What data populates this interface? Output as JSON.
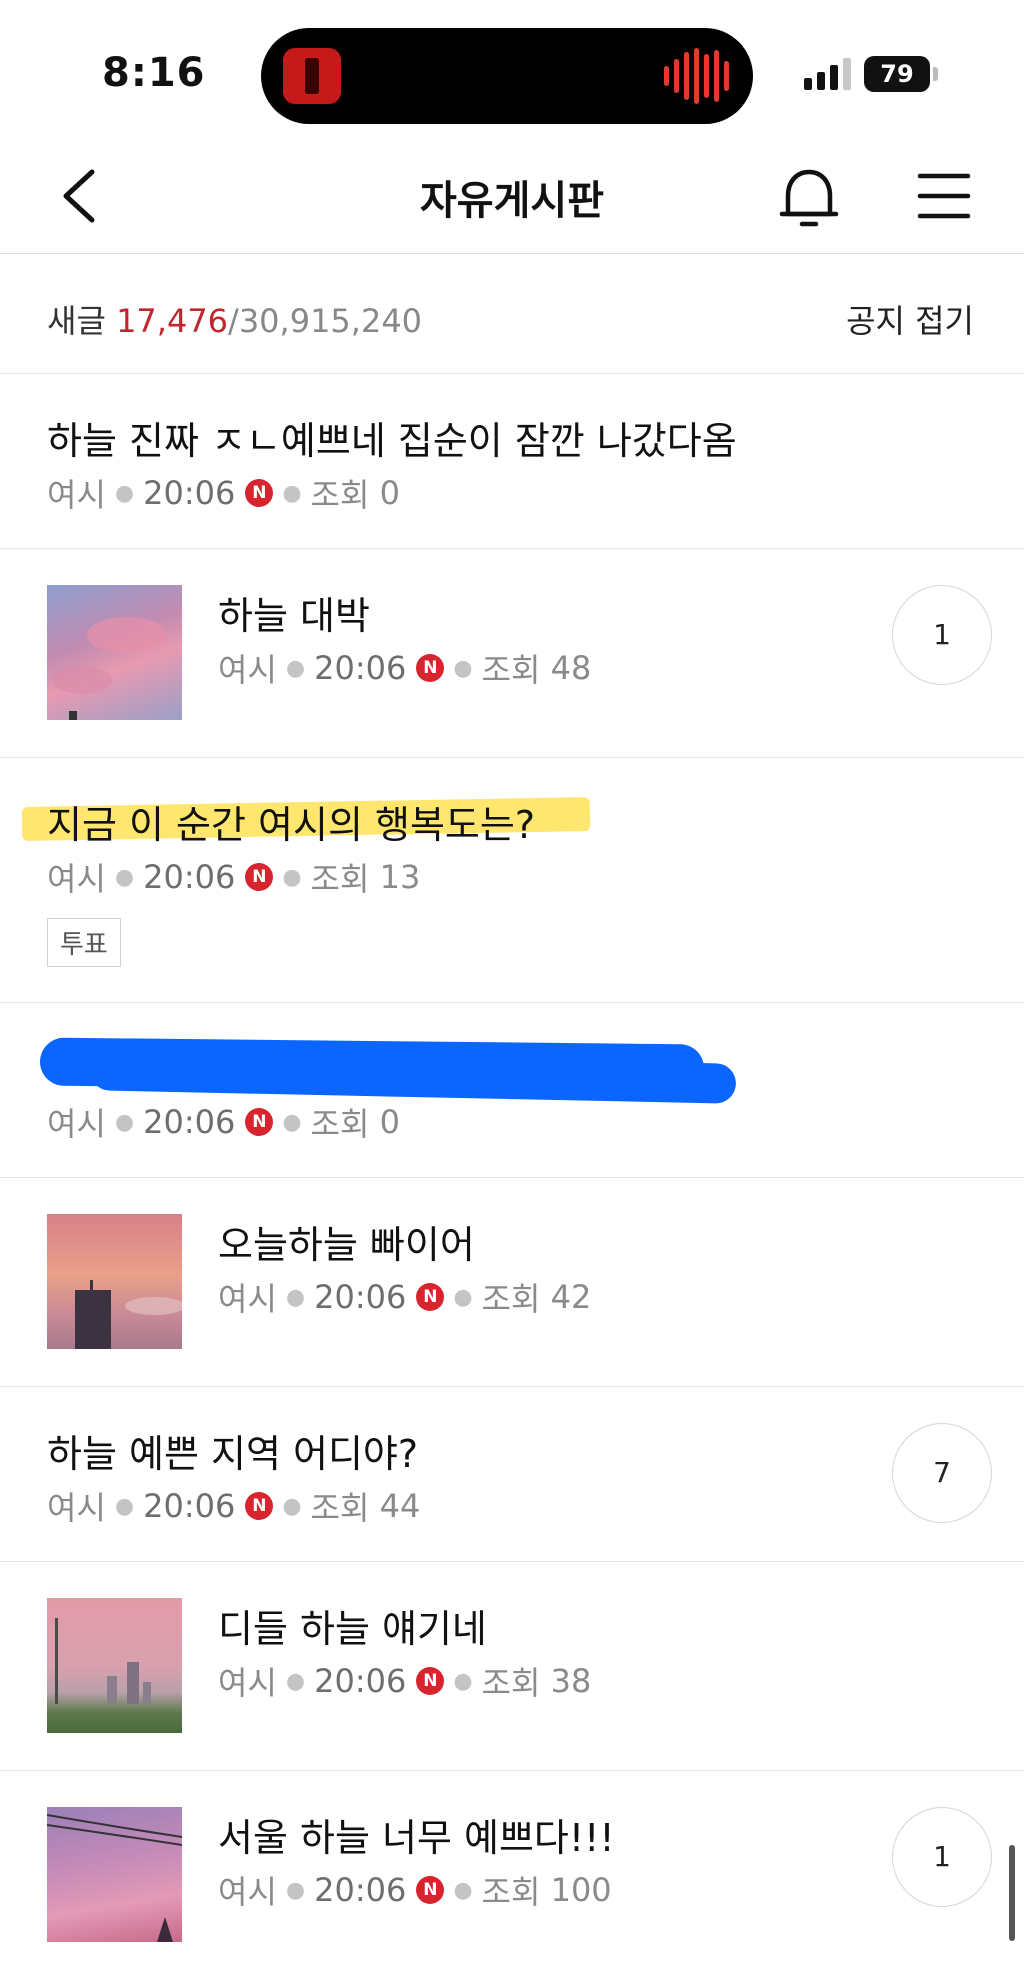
{
  "status": {
    "time": "8:16",
    "battery": "79"
  },
  "nav": {
    "title": "자유게시판"
  },
  "counts": {
    "label": "새글",
    "new": "17,476",
    "total": "/30,915,240",
    "notice": "공지 접기"
  },
  "meta_common": {
    "author": "여시",
    "time": "20:06",
    "views_label": "조회",
    "new_badge": "N"
  },
  "posts": [
    {
      "title": "하늘 진짜 ㅈㄴ예쁘네 집순이 잠깐 나갔다옴",
      "views": "0"
    },
    {
      "title": "하늘 대박",
      "views": "48",
      "comments": "1"
    },
    {
      "title": "지금 이 순간 여시의 행복도는?",
      "views": "13",
      "tag": "투표"
    },
    {
      "title": "",
      "views": "0"
    },
    {
      "title": "오늘하늘 빠이어",
      "views": "42"
    },
    {
      "title": "하늘 예쁜 지역 어디야?",
      "views": "44",
      "comments": "7"
    },
    {
      "title": "디들 하늘 얘기네",
      "views": "38"
    },
    {
      "title": "서울 하늘 너무 예쁘다!!!",
      "views": "100",
      "comments": "1"
    }
  ],
  "colors": {
    "accent_red": "#c0262d",
    "new_badge": "#d8242e",
    "highlight": "#ffe356",
    "redaction": "#0a66ff"
  }
}
